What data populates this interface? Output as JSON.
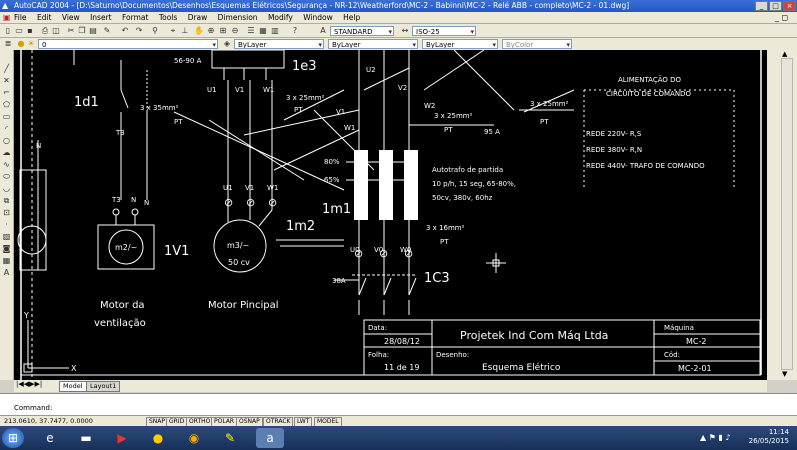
{
  "window": {
    "title": "AutoCAD 2004 - [D:\\Saturno\\Documentos\\Desenhos\\Esquemas Elétricos\\Segurança - NR-12\\Weatherford\\MC-2 - Babinni\\MC-2 - Relé ABB - completo\\MC-2 - 01.dwg]"
  },
  "menu": [
    "File",
    "Edit",
    "View",
    "Insert",
    "Format",
    "Tools",
    "Draw",
    "Dimension",
    "Modify",
    "Window",
    "Help"
  ],
  "toolbar": {
    "text_style": "STANDARD",
    "dim_style": "ISO-25",
    "layer": "0",
    "color": "ByLayer",
    "linetype": "ByLayer",
    "lineweight": "ByLayer",
    "plotstyle": "ByColor"
  },
  "drawing": {
    "contactor_top": "1e3",
    "contactor_top_partial": "56-90 A",
    "disconnect_1d1": "1d1",
    "terminal_t3_upper": "T3",
    "terminal_n_upper": "N",
    "terminal_n_left": "N",
    "terminal_u1_a": "U1",
    "terminal_v1_a": "V1",
    "terminal_w1_a": "W1",
    "terminal_u2": "U2",
    "terminal_v2": "V2",
    "terminal_w2": "W2",
    "cable_35_left": "3 x 35mm²",
    "cable_pt_left": "PT",
    "cable_25_mid": "3 x 25mm²",
    "cable_pt_mid": "PT",
    "cable_25_right": "3 x 25mm²",
    "cable_pt_right": "PT",
    "cable_25_far": "3 x 25mm²",
    "cable_pt_far": "PT",
    "amps_95": "95 A",
    "label_w1_mid": "W1",
    "label_v1_mid": "V1",
    "pct_80": "80%",
    "pct_65": "65%",
    "auto_desc_1": "Autotrafo de partida",
    "auto_desc_2": "10 p/h, 15 seg, 65-80%,",
    "auto_desc_3": "50cv, 380v, 60hz",
    "auto_tag": "1m1",
    "cable_16": "3 x 16mm²",
    "cable_pt_16": "PT",
    "u0": "U0",
    "v0": "V0",
    "w0": "W0",
    "amps_38": "38A",
    "contactor_1c3": "1C3",
    "motor_vent_t3": "T3",
    "motor_vent_n": "N",
    "motor_vent_rating": "m2/~",
    "motor_vent_tag": "1V1",
    "motor_vent_label_1": "Motor da",
    "motor_vent_label_2": "ventilação",
    "motor_main_u1": "U1",
    "motor_main_v1": "V1",
    "motor_main_w1": "W1",
    "motor_main_rating": "m3/~",
    "motor_main_power": "50 cv",
    "motor_main_tag": "1m2",
    "motor_main_label": "Motor Pincipal",
    "supply_title_1": "ALIMENTAÇÃO DO",
    "supply_title_2": "CIRCUITO DE COMANDO",
    "supply_line_1": "REDE 220V- R,S",
    "supply_line_2": "REDE 380V- R,N",
    "supply_line_3": "REDE 440V- TRAFO DE COMANDO",
    "ucs_y": "Y",
    "ucs_x": "X",
    "titleblock": {
      "date_label": "Data:",
      "date_value": "28/08/12",
      "sheet_label": "Folha:",
      "sheet_value": "11 de 19",
      "company": "Projetek Ind Com Máq Ltda",
      "drawing_label": "Desenho:",
      "drawing_value": "Esquema Elétrico",
      "machine_label": "Máquina",
      "machine_value": "MC-2",
      "code_label": "Cód:",
      "code_value": "MC-2-01"
    }
  },
  "tabs": [
    "Model",
    "Layout1"
  ],
  "command_prompt": "Command:",
  "status": {
    "coords": "213.0610, 37.7477, 0.0000",
    "buttons": [
      "SNAP",
      "GRID",
      "ORTHO",
      "POLAR",
      "OSNAP",
      "OTRACK",
      "LWT",
      "MODEL"
    ]
  },
  "clock": {
    "time": "11:14",
    "date": "26/05/2015"
  }
}
